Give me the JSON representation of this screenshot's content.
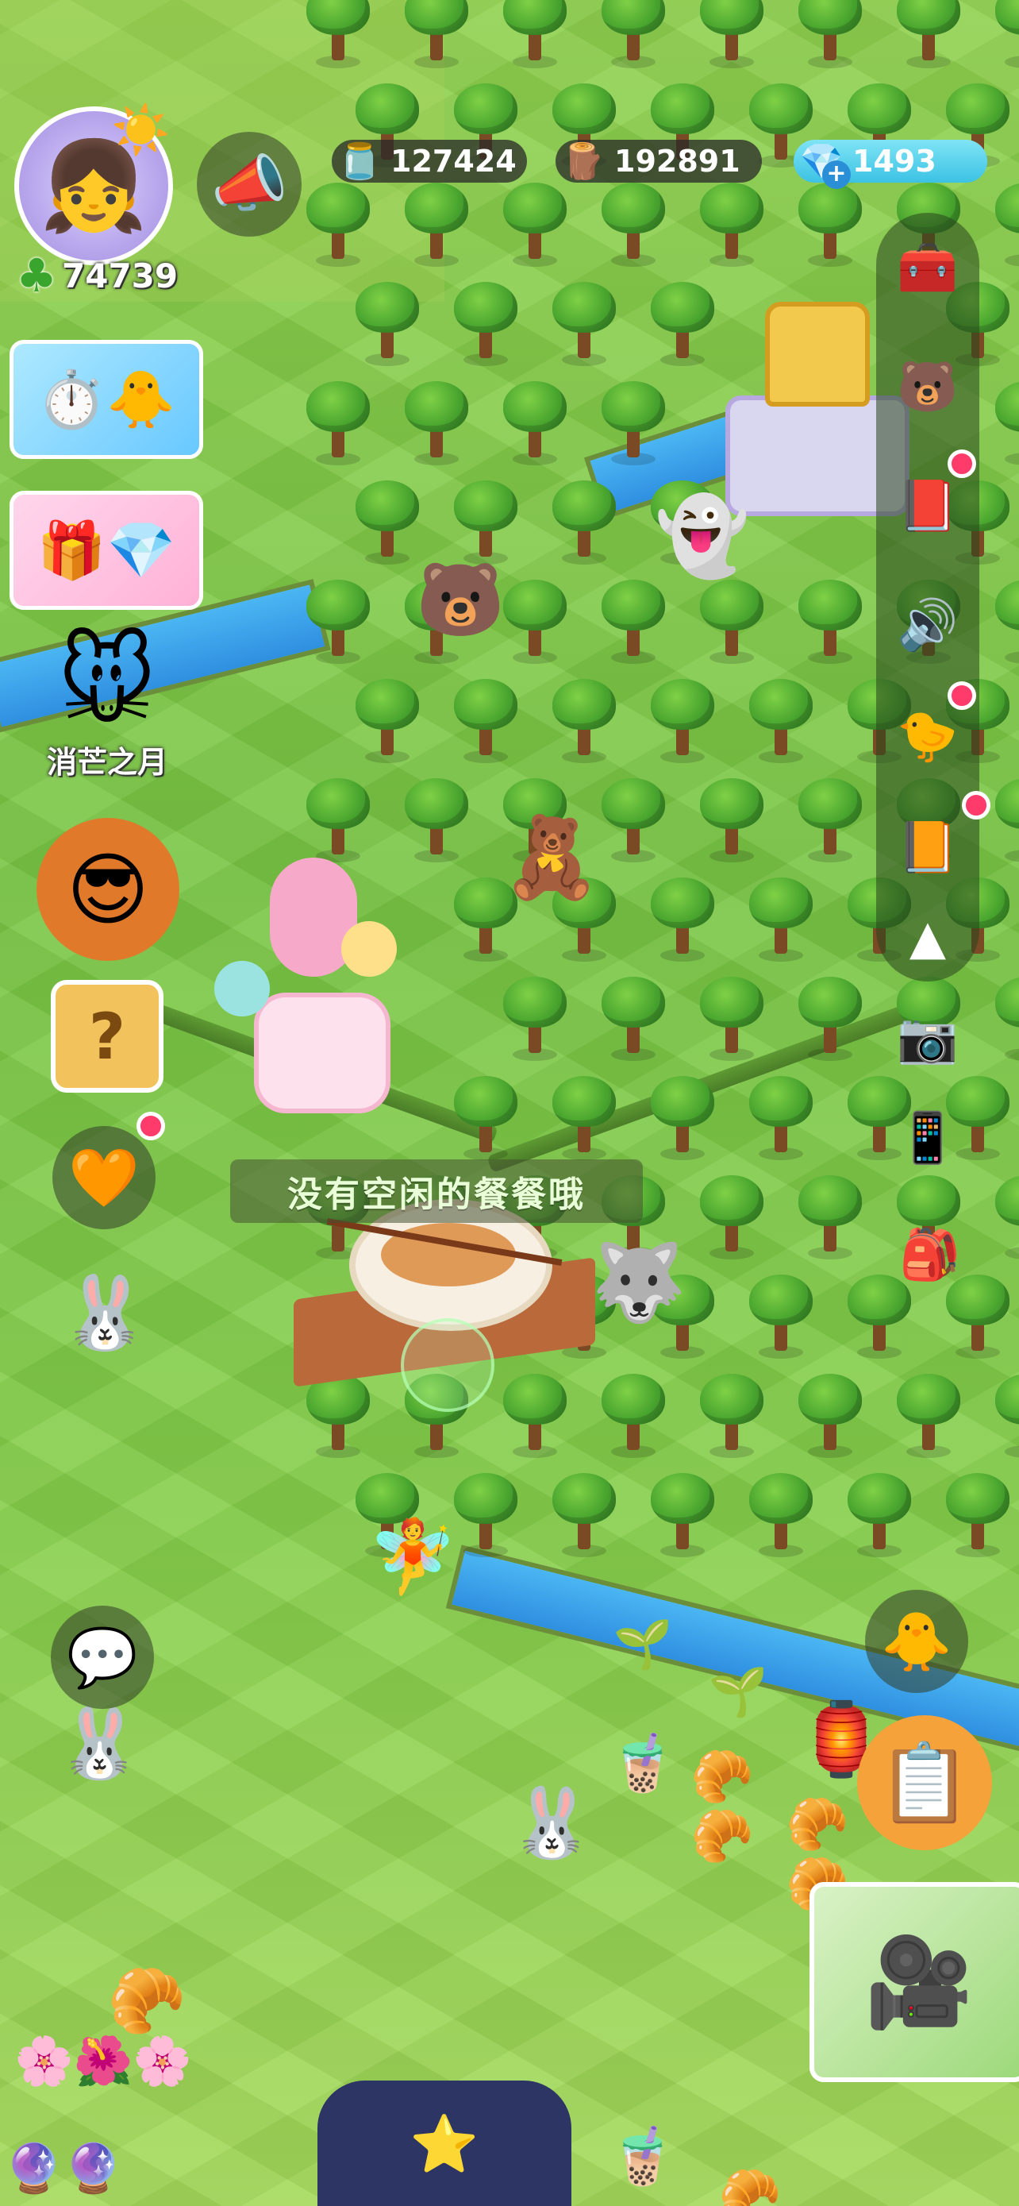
{
  "hud": {
    "clover_count": "74739",
    "jam_count": "127424",
    "wood_count": "192891",
    "gem_count": "1493"
  },
  "left_menu": {
    "moon_label": "消芒之月"
  },
  "toast": {
    "message": "没有空闲的餐餐哦"
  },
  "icons": {
    "clover": "clover-icon",
    "jam": "jam-jar-icon",
    "wood": "wood-log-icon",
    "gem": "gem-icon",
    "megaphone": "megaphone-icon"
  },
  "colors": {
    "notification": "#ff3b6b",
    "grass": "#7cc94a",
    "river": "#3aa3ea",
    "toast_text": "#e8ffd8"
  }
}
